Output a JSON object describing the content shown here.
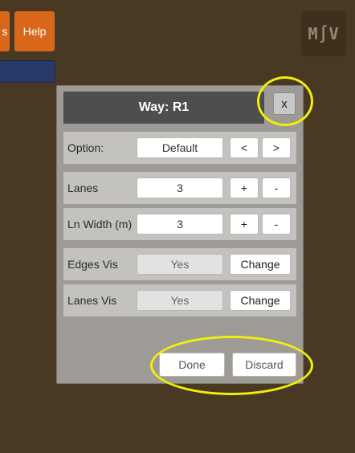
{
  "top_left": {
    "partial_button_label": "s",
    "help_label": "Help"
  },
  "logo": {
    "text": "M∫V"
  },
  "dialog": {
    "title": "Way: R1",
    "close_label": "x",
    "rows": [
      {
        "label": "Option:",
        "value": "Default",
        "btn1": "<",
        "btn2": ">"
      },
      {
        "label": "Lanes",
        "value": "3",
        "btn1": "+",
        "btn2": "-"
      },
      {
        "label": "Ln Width (m)",
        "value": "3",
        "btn1": "+",
        "btn2": "-"
      },
      {
        "label": "Edges Vis",
        "value": "Yes",
        "btn": "Change"
      },
      {
        "label": "Lanes Vis",
        "value": "Yes",
        "btn": "Change"
      }
    ],
    "done_label": "Done",
    "discard_label": "Discard"
  },
  "colors": {
    "background": "#4a3922",
    "accent_orange": "#d8671c",
    "highlight_yellow": "#f2ee0a"
  }
}
